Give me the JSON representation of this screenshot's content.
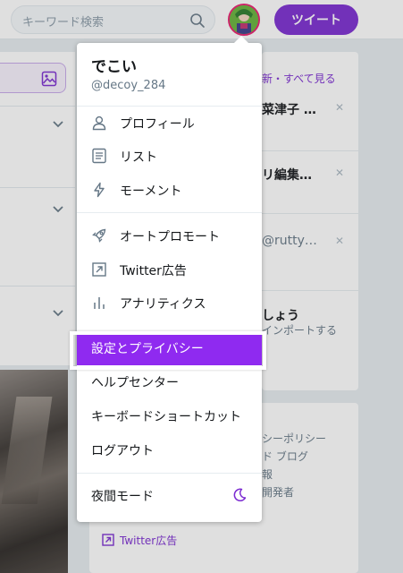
{
  "header": {
    "search_placeholder": "キーワード検索",
    "tweet_button": "ツイート"
  },
  "trends": {
    "see_all": "新・すべて見る",
    "items": [
      {
        "title": "菜津子 …"
      },
      {
        "title": "リ編集…"
      },
      {
        "title": "@rutty…"
      }
    ],
    "follow_title": "しょう",
    "follow_sub": "インポートする"
  },
  "footer": {
    "line1": "シーポリシー",
    "line2": "ド  ブログ",
    "line3": "報",
    "line4": "開発者",
    "ad_link": "Twitter広告"
  },
  "menu": {
    "display_name": "でこい",
    "handle": "@decoy_284",
    "items": [
      {
        "label": "プロフィール",
        "icon": "person-icon"
      },
      {
        "label": "リスト",
        "icon": "list-icon"
      },
      {
        "label": "モーメント",
        "icon": "bolt-icon"
      },
      {
        "label": "オートプロモート",
        "icon": "rocket-icon"
      },
      {
        "label": "Twitter広告",
        "icon": "external-link-icon"
      },
      {
        "label": "アナリティクス",
        "icon": "bar-chart-icon"
      },
      {
        "label": "設定とプライバシー"
      },
      {
        "label": "ヘルプセンター"
      },
      {
        "label": "キーボードショートカット"
      },
      {
        "label": "ログアウト"
      },
      {
        "label": "夜間モード",
        "icon": "moon-icon"
      }
    ]
  },
  "colors": {
    "accent": "#7b2bd1",
    "selected_bg": "#8f2af0"
  }
}
